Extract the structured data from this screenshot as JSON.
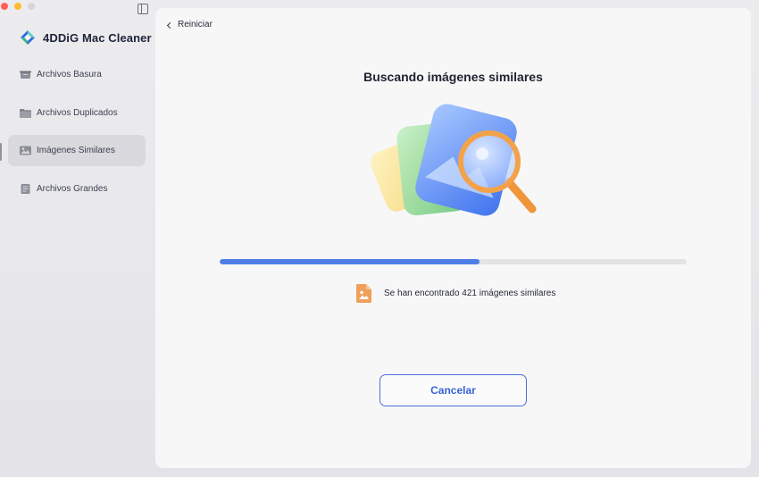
{
  "app": {
    "name": "4DDiG Mac Cleaner"
  },
  "sidebar": {
    "items": [
      {
        "label": "Archivos Basura",
        "icon": "trash-bin-icon",
        "active": false
      },
      {
        "label": "Archivos Duplicados",
        "icon": "folder-icon",
        "active": false
      },
      {
        "label": "Imágenes Similares",
        "icon": "image-icon",
        "active": true
      },
      {
        "label": "Archivos Grandes",
        "icon": "large-file-icon",
        "active": false
      }
    ]
  },
  "main": {
    "back_label": "Reiniciar",
    "title": "Buscando imágenes similares",
    "progress_fraction": 0.557,
    "found_text": "Se han encontrado 421 imágenes similares",
    "cancel_label": "Cancelar"
  },
  "colors": {
    "accent": "#4f7ee6",
    "button_border": "#4a6fd8",
    "found_icon": "#f0a05a"
  }
}
